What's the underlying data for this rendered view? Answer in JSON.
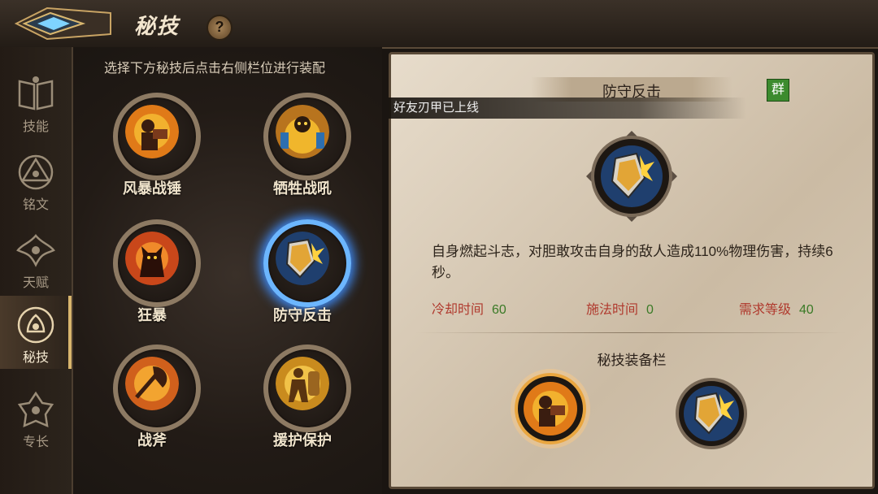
{
  "header": {
    "title": "秘技",
    "help_label": "?"
  },
  "nav": {
    "items": [
      {
        "label": "技能",
        "icon": "book-icon"
      },
      {
        "label": "铭文",
        "icon": "triangle-rune-icon"
      },
      {
        "label": "天赋",
        "icon": "talent-icon"
      },
      {
        "label": "秘技",
        "icon": "secret-skill-icon"
      },
      {
        "label": "专长",
        "icon": "specialty-icon"
      }
    ],
    "active": "秘技"
  },
  "instruction": "选择下方秘技后点击右侧栏位进行装配",
  "skills": [
    {
      "name": "风暴战锤"
    },
    {
      "name": "牺牲战吼"
    },
    {
      "name": "狂暴"
    },
    {
      "name": "防守反击"
    },
    {
      "name": "战斧"
    },
    {
      "name": "援护保护"
    }
  ],
  "toast": "好友刃甲已上线",
  "detail": {
    "title": "防守反击",
    "group_badge": "群",
    "description": "自身燃起斗志，对胆敢攻击自身的敌人造成110%物理伤害，持续6秒。",
    "cooldown_label": "冷却时间",
    "cooldown_value": "60",
    "cast_label": "施法时间",
    "cast_value": "0",
    "level_label": "需求等级",
    "level_value": "40",
    "equip_title": "秘技装备栏"
  },
  "colors": {
    "accent": "#d8b56d",
    "stat_label": "#b03a2e",
    "stat_value": "#3a7a26",
    "badge": "#3c8b2e",
    "selected_glow": "#3f8fff"
  }
}
